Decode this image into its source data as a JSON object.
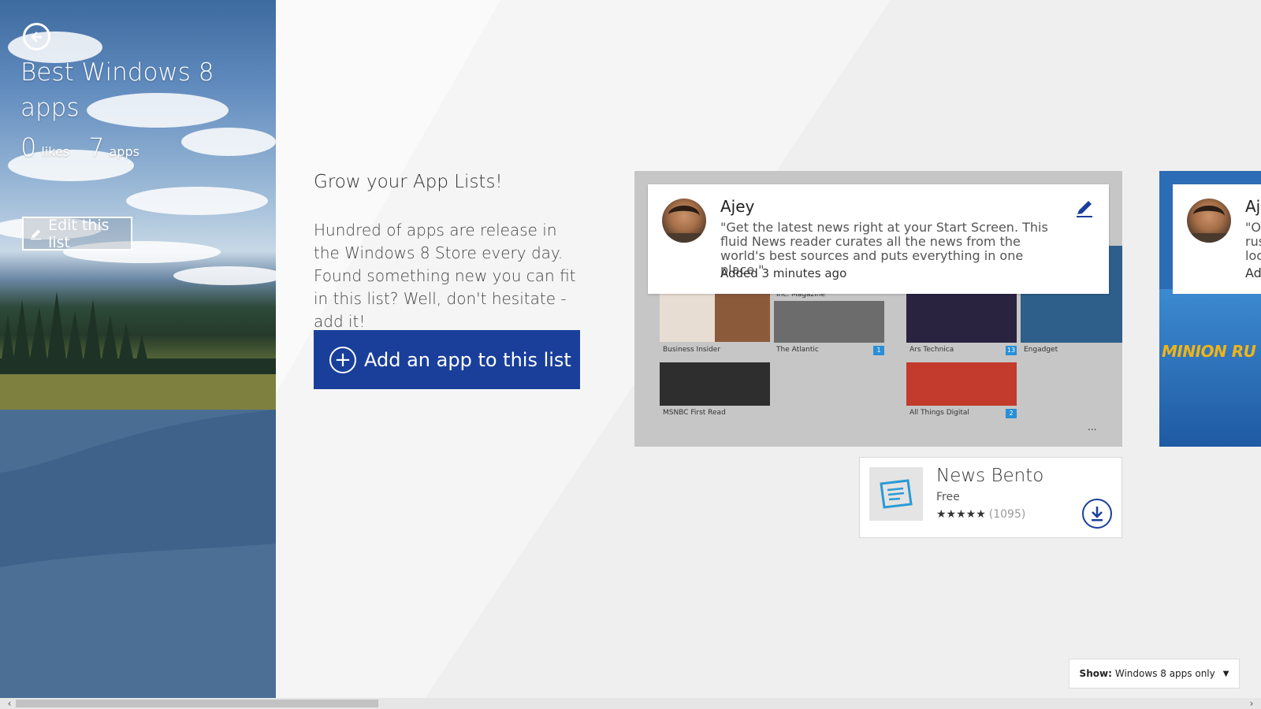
{
  "hero": {
    "title": "Best Windows 8 apps",
    "likes_count": "0",
    "likes_label": "likes",
    "apps_count": "7",
    "apps_label": "apps",
    "edit_label": "Edit this list"
  },
  "intro": {
    "title": "Grow your App Lists!",
    "body": "Hundred of apps are release in the Windows 8 Store every day. Found something new you can fit in this list? Well, don't hesitate - add it!",
    "add_button": "Add an app to this list"
  },
  "card1": {
    "tiles": [
      {
        "label": "Business Insider"
      },
      {
        "label": "Inc. Magazine"
      },
      {
        "label": "The Atlantic",
        "badge": "1"
      },
      {
        "label": "Ars Technica",
        "badge": "13"
      },
      {
        "label": "Engadget"
      },
      {
        "label": "MSNBC First Read"
      },
      {
        "label": "All Things Digital",
        "badge": "2"
      }
    ],
    "more": "...",
    "review": {
      "author": "Ajey",
      "text": "\"Get the latest news right at your Start Screen. This fluid News reader curates all the news from the world's best sources and puts everything in one place.\"",
      "time": "Added 3 minutes ago"
    },
    "app": {
      "name": "News Bento",
      "price": "Free",
      "stars": "★★★★★",
      "rating_count": "(1095)"
    }
  },
  "card2": {
    "author": "Aj",
    "text_lines": [
      "\"O",
      "rus",
      "loc",
      "Ad"
    ],
    "art_text": "MINION RU"
  },
  "filter": {
    "label": "Show:",
    "value": "Windows 8 apps only"
  },
  "colors": {
    "accent": "#1a3f9b",
    "tile_badge": "#2a8fd6"
  }
}
